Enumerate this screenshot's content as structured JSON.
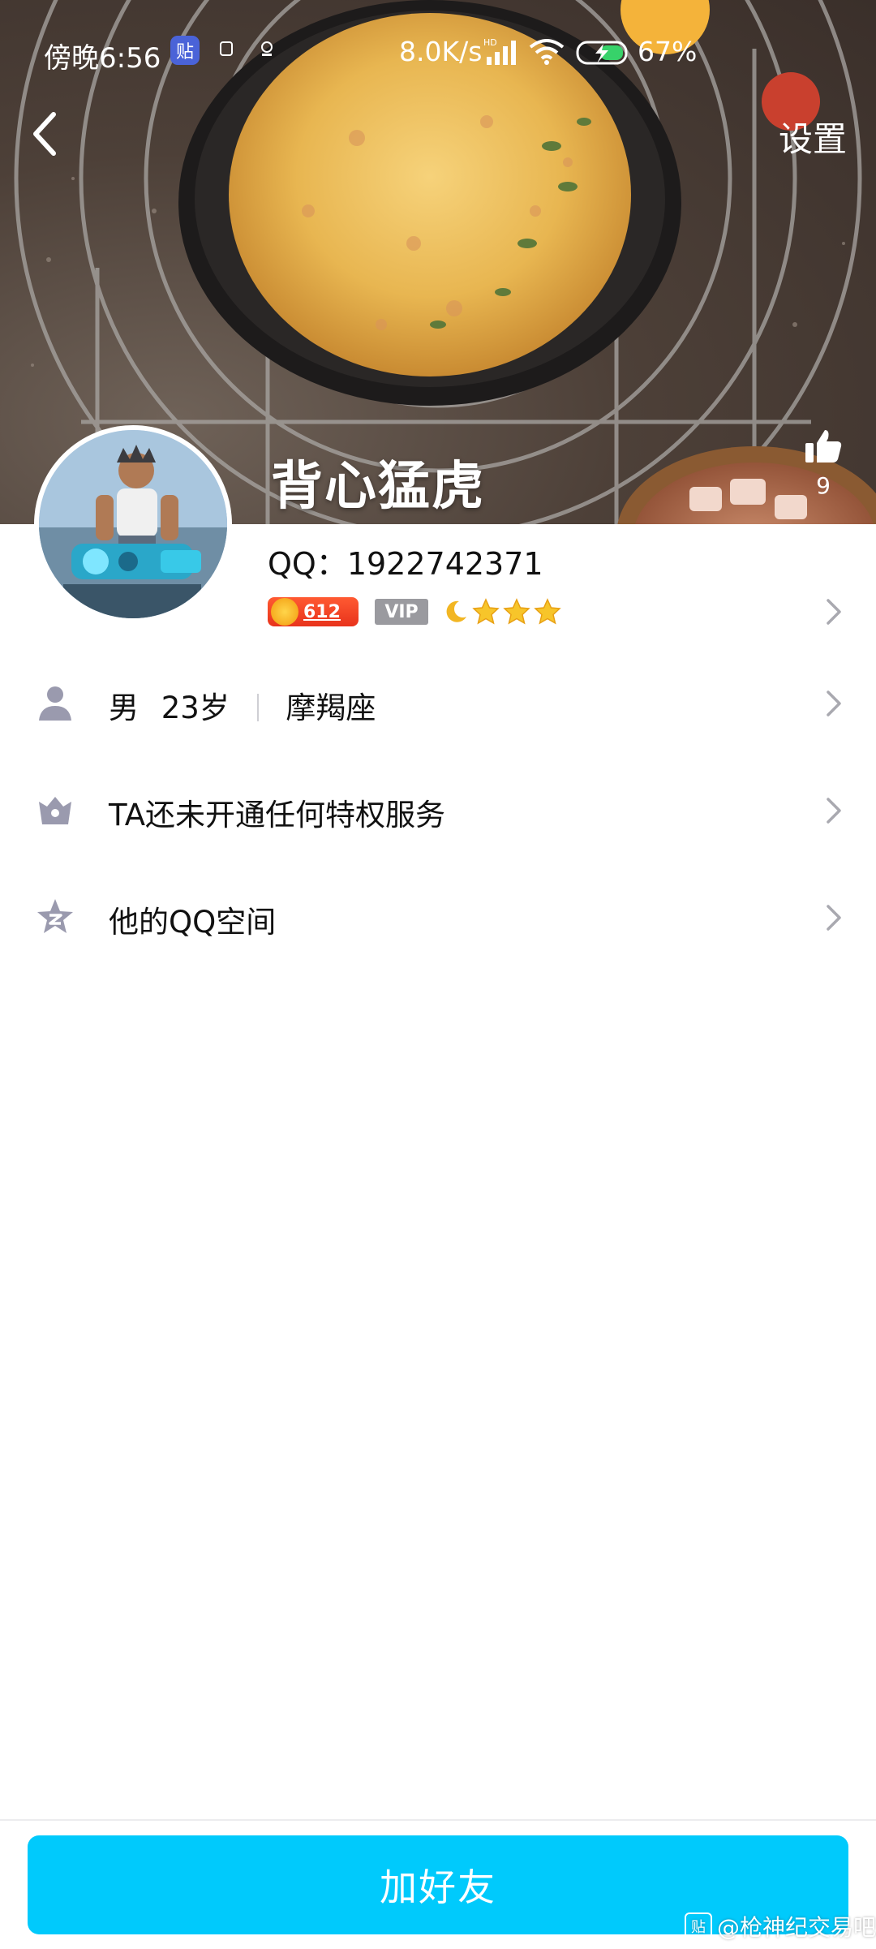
{
  "status_bar": {
    "time": "傍晚6:56",
    "app_badge_text": "贴",
    "network_speed": "8.0K/s",
    "network_type": "HD",
    "battery": "67%"
  },
  "header": {
    "settings_label": "设置",
    "nickname": "背心猛虎",
    "like_count": "9"
  },
  "profile": {
    "qq_label": "QQ：1922742371",
    "level_value": "612",
    "vip_label": "VIP",
    "level_icons": [
      "moon-icon",
      "star-icon",
      "star-icon",
      "star-icon"
    ]
  },
  "rows": [
    {
      "gender": "男",
      "age": "23岁",
      "zodiac": "摩羯座",
      "icon": "person-icon"
    },
    {
      "text": "TA还未开通任何特权服务",
      "icon": "crown-icon"
    },
    {
      "text": "他的QQ空间",
      "icon": "qzone-star-icon"
    }
  ],
  "footer": {
    "add_friend_label": "加好友",
    "watermark_icon_text": "贴",
    "watermark_text": "@枪神纪交易吧"
  },
  "colors": {
    "accent": "#00cafc",
    "icon_gray": "#9a9aae",
    "level_badge": "#e8331c"
  }
}
